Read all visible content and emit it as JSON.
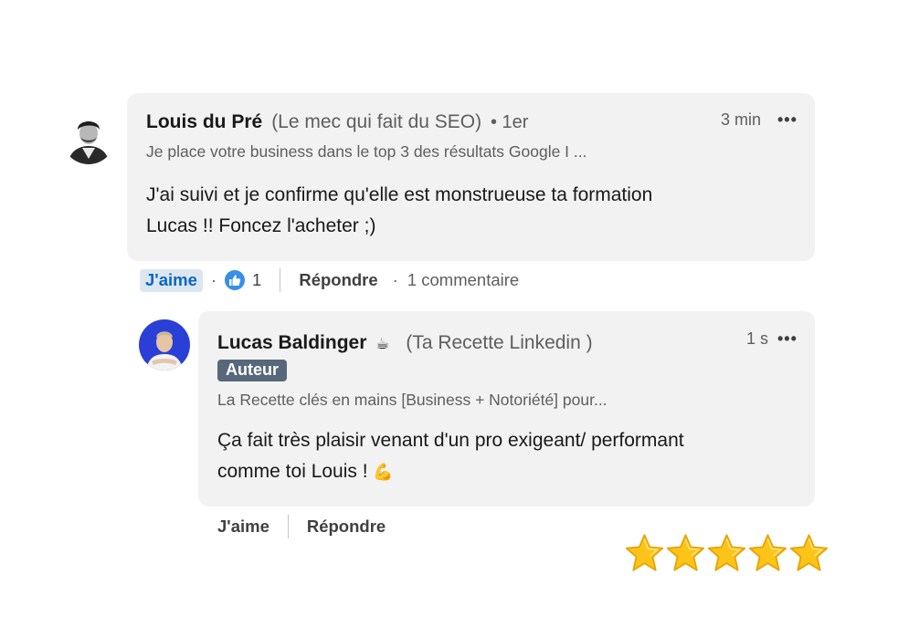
{
  "comment": {
    "author_name": "Louis du Pré",
    "author_pronoun": "(Le mec qui fait du SEO)",
    "degree": "• 1er",
    "headline": "Je place votre business dans le top 3 des résultats Google I ...",
    "time": "3 min",
    "more": "•••",
    "body_line1": "J'ai suivi et je confirme qu'elle est monstrueuse ta formation",
    "body_line2": "Lucas !! Foncez l'acheter ;)",
    "actions": {
      "like_label": "J'aime",
      "dot": "·",
      "reaction_count": "1",
      "reply_label": "Répondre",
      "dot2": "·",
      "comment_count": "1 commentaire"
    }
  },
  "reply": {
    "author_name": "Lucas Baldinger",
    "emoji": "☕",
    "author_pronoun": "(Ta Recette Linkedin )",
    "badge": "Auteur",
    "headline": "La Recette clés en mains [Business + Notoriété] pour...",
    "time": "1 s",
    "more": "•••",
    "body_line1": "Ça fait très plaisir venant d'un pro exigeant/ performant",
    "body_line2": "comme toi Louis !",
    "body_emoji": "💪",
    "actions": {
      "like_label": "J'aime",
      "reply_label": "Répondre"
    }
  },
  "rating": {
    "stars": 5,
    "icon": "star-icon"
  },
  "colors": {
    "bubble": "#f2f2f2",
    "like_active": "#0a66c2",
    "badge": "#56687a",
    "reaction": "#378fe9",
    "star": "#fcc419"
  }
}
